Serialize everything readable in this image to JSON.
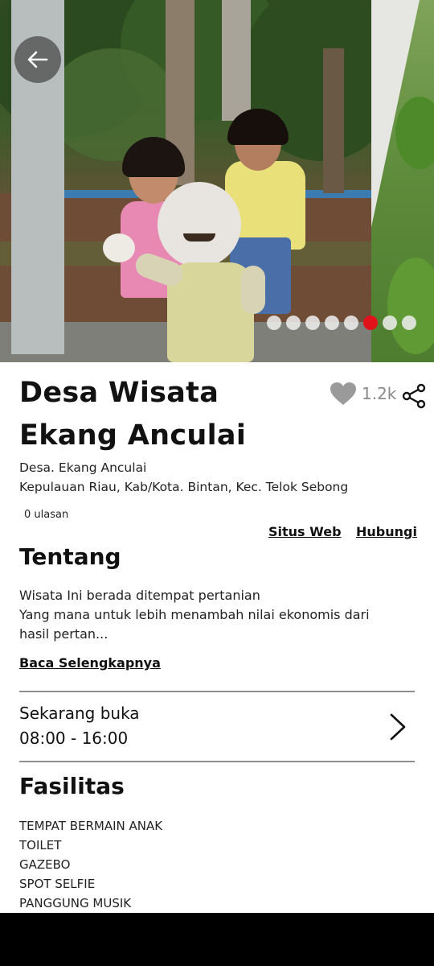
{
  "place": {
    "title": "Desa Wisata Ekang Anculai",
    "favorite_count": "1.2k",
    "address_line1": "Desa. Ekang Anculai",
    "address_line2": "Kepulauan Riau, Kab/Kota. Bintan, Kec. Telok Sebong",
    "reviews": "0 ulasan"
  },
  "links": {
    "website": "Situs Web",
    "contact": "Hubungi"
  },
  "about": {
    "heading": "Tentang",
    "line1": "Wisata Ini berada ditempat pertanian",
    "line2": "Yang mana untuk lebih menambah nilai ekonomis dari",
    "line3": "hasil pertan...",
    "read_more": "Baca Selengkapnya"
  },
  "hours": {
    "status": "Sekarang buka",
    "time": "08:00 - 16:00"
  },
  "facilities": {
    "heading": "Fasilitas",
    "items": [
      "TEMPAT BERMAIN ANAK",
      "TOILET",
      "GAZEBO",
      "SPOT SELFIE",
      "PANGGUNG MUSIK"
    ]
  },
  "carousel": {
    "total": 8,
    "active_index": 5
  },
  "icons": {
    "back": "arrow-left-icon",
    "favorite": "heart-icon",
    "share": "share-icon",
    "open": "chevron-right-icon"
  },
  "colors": {
    "accent": "#e0121b",
    "heart": "#9a9a9a",
    "divider": "#8e8e8e"
  }
}
